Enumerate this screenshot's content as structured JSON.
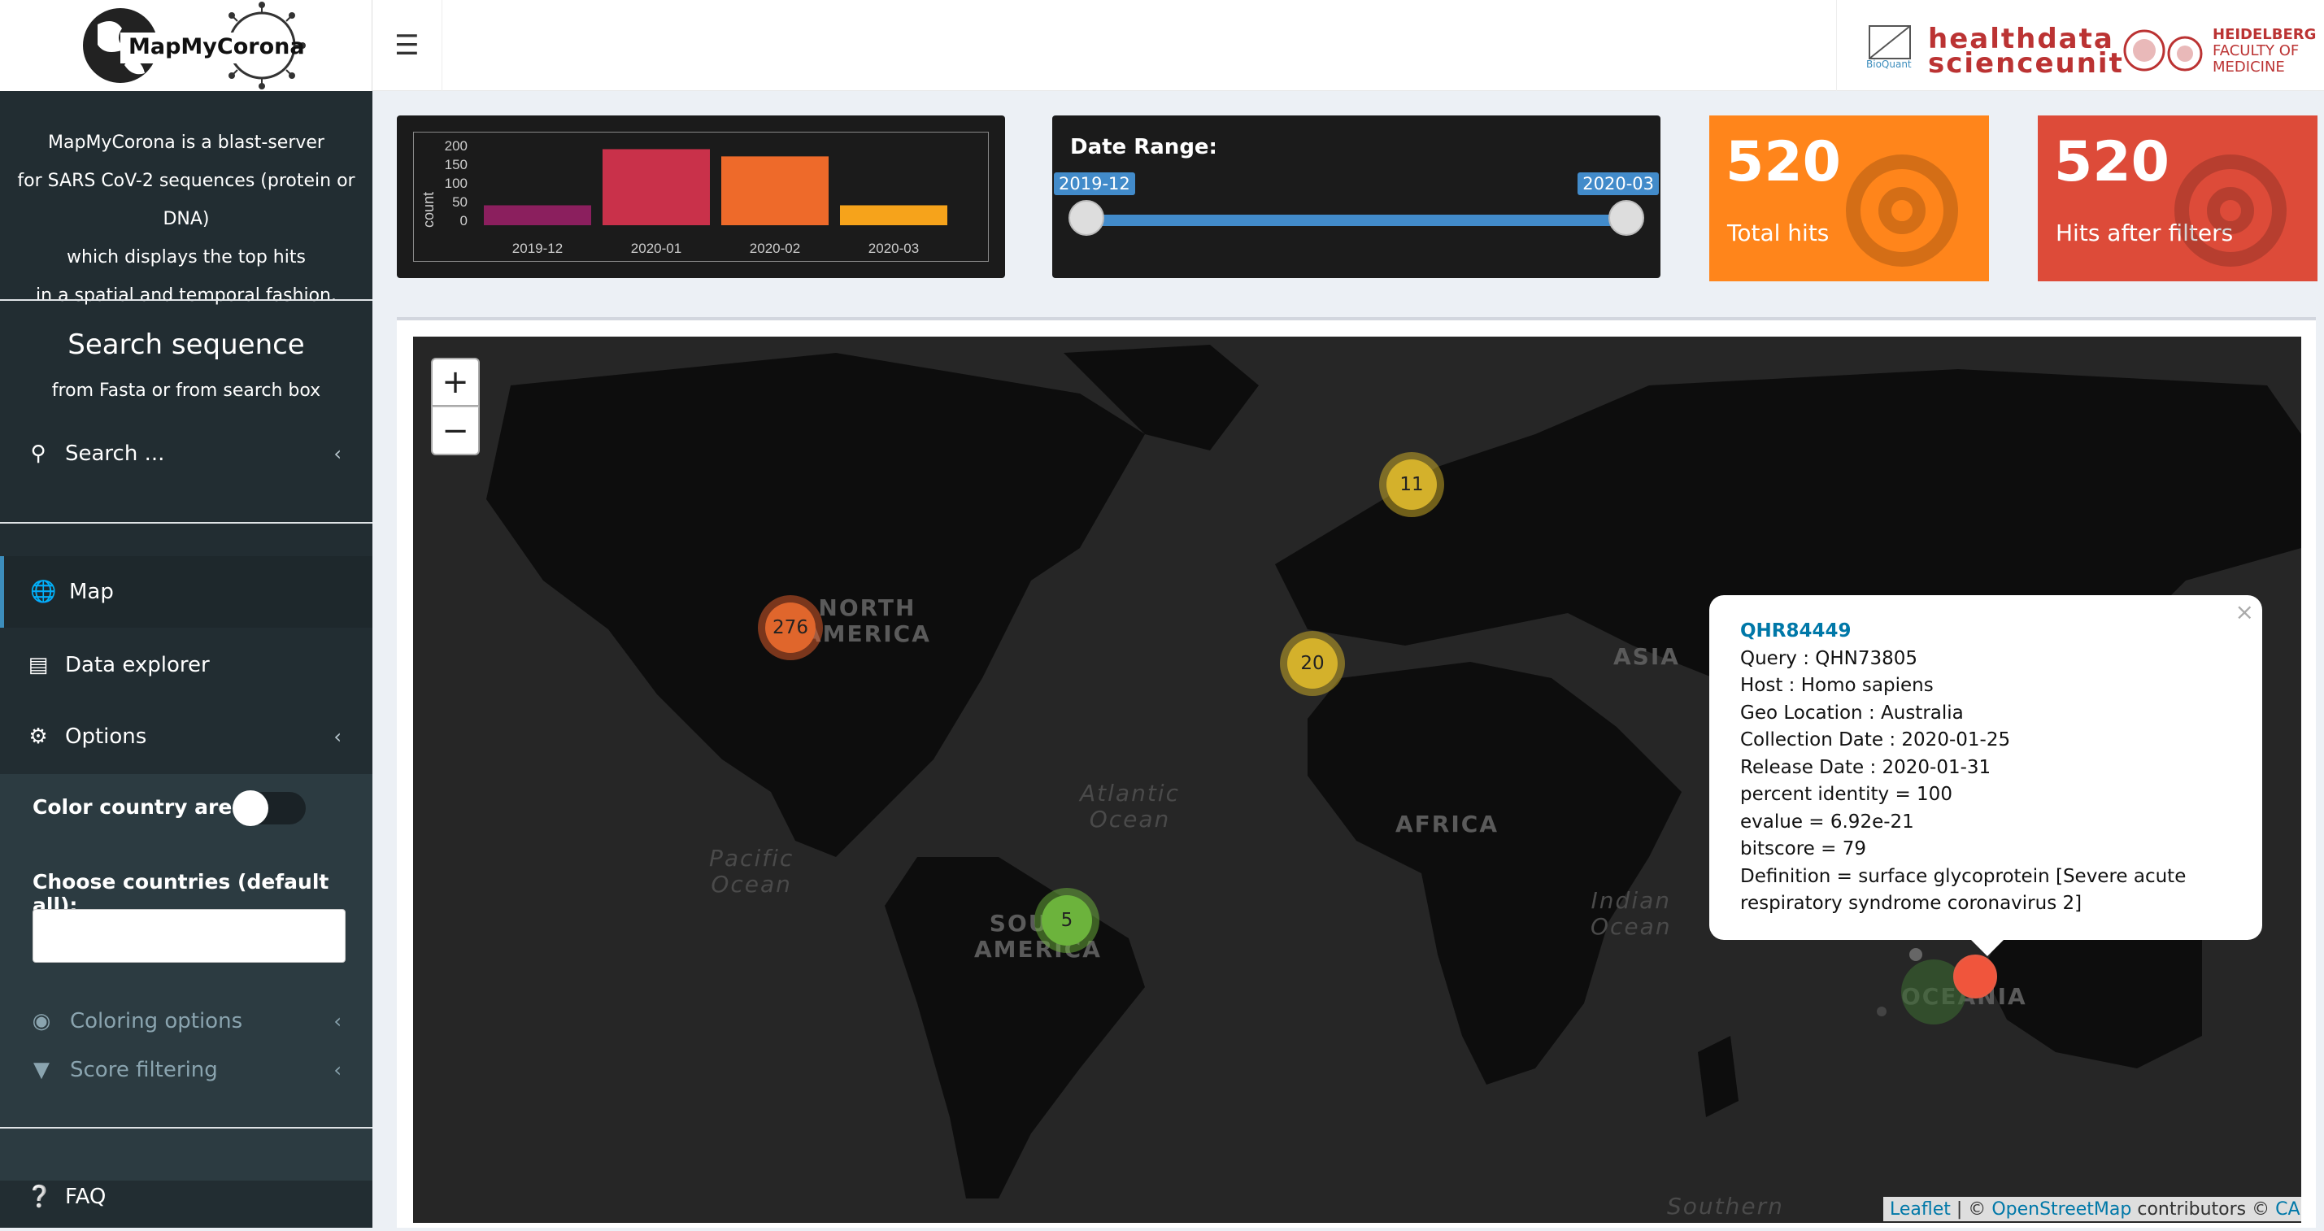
{
  "app": {
    "logo_text": "MapMyCorona",
    "partner_logo_line1": "healthdata",
    "partner_logo_line2": "scienceunit",
    "partner_bioquant": "BioQuant",
    "partner_faculty_lines": [
      "HEIDELBERG",
      "FACULTY OF",
      "MEDICINE"
    ]
  },
  "sidebar": {
    "about_lines": [
      "MapMyCorona is a blast-server",
      "for SARS CoV-2 sequences (protein or DNA)",
      "which displays the top hits",
      "in a spatial and temporal fashion."
    ],
    "search_title": "Search sequence",
    "search_subtitle": "from Fasta or from search box",
    "search_label": "Search ...",
    "menu": {
      "map": "Map",
      "data_explorer": "Data explorer",
      "options": "Options",
      "color_country_area": "Color country area",
      "choose_countries": "Choose countries (default all):",
      "coloring_options": "Coloring options",
      "score_filtering": "Score filtering",
      "faq": "FAQ"
    }
  },
  "histogram": {
    "ylabel": "count",
    "yticks": [
      "200",
      "150",
      "100",
      "50",
      "0"
    ],
    "chart_data": {
      "type": "bar",
      "categories": [
        "2019-12",
        "2020-01",
        "2020-02",
        "2020-03"
      ],
      "values": [
        55,
        210,
        190,
        55
      ],
      "ylim": [
        0,
        220
      ],
      "colors": [
        "#8b1f5e",
        "#c9314a",
        "#ee6a2a",
        "#f6a31b"
      ]
    }
  },
  "date_range": {
    "title": "Date Range:",
    "from": "2019-12",
    "to": "2020-03"
  },
  "value_boxes": {
    "total": {
      "value": "520",
      "label": "Total hits"
    },
    "filtered": {
      "value": "520",
      "label": "Hits after filters"
    }
  },
  "map": {
    "zoom_in": "+",
    "zoom_out": "−",
    "clusters": [
      "276",
      "11",
      "20",
      "5"
    ],
    "labels": {
      "north_america": [
        "NORTH",
        "AMERICA"
      ],
      "south_america": [
        "SOUTH",
        "AMERICA"
      ],
      "asia": "ASIA",
      "africa": "AFRICA",
      "oceania": "OCEANIA",
      "atlantic": [
        "Atlantic",
        "Ocean"
      ],
      "pacific": [
        "Pacific",
        "Ocean"
      ],
      "indian": [
        "Indian",
        "Ocean"
      ],
      "southern": "Southern"
    },
    "popup": {
      "id": "QHR84449",
      "lines": [
        "Query : QHN73805",
        "Host : Homo sapiens",
        "Geo Location : Australia",
        "Collection Date : 2020-01-25",
        "Release Date : 2020-01-31",
        "percent identity = 100",
        "evalue = 6.92e-21",
        "bitscore = 79",
        "Definition = surface glycoprotein [Severe acute",
        "respiratory syndrome coronavirus 2]"
      ],
      "close": "×"
    },
    "attribution": {
      "leaflet": "Leaflet",
      "sep": " | © ",
      "osm": "OpenStreetMap",
      "contrib": " contributors © ",
      "carto": "CARTO"
    }
  }
}
